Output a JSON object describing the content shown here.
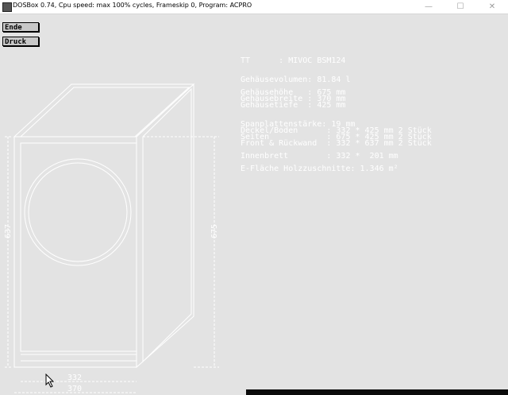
{
  "window": {
    "title": "DOSBox 0.74, Cpu speed: max 100% cycles, Frameskip  0, Program:   ACPRO",
    "minimize": "—",
    "maximize": "☐",
    "close": "✕"
  },
  "toolbar": {
    "ende_label": "Ende",
    "druck_label": "Druck"
  },
  "specs": {
    "tt": "TT      : MIVOC BSM124",
    "volume": "Gehäusevolumen: 81.84 l",
    "hoehe": "Gehäusehöhe   : 675 mm",
    "breite": "Gehäusebreite : 370 mm",
    "tiefe": "Gehäusetiefe  : 425 mm",
    "spanplatte": "Spanplattenstärke: 19 mm",
    "deckel": "Deckel/Boden      : 332 * 425 mm 2 Stück",
    "seiten": "Seiten            : 675 * 425 mm 2 Stück",
    "front": "Front & Rückwand  : 332 * 637 mm 2 Stück",
    "innenbrett": "Innenbrett        : 332 *  201 mm",
    "flaeche": "E-Fläche Holzzuschnitte: 1.346 m²"
  },
  "drawing": {
    "dim_height_inner": "637",
    "dim_height_outer": "675",
    "dim_width_inner": "332",
    "dim_width_outer": "370"
  }
}
